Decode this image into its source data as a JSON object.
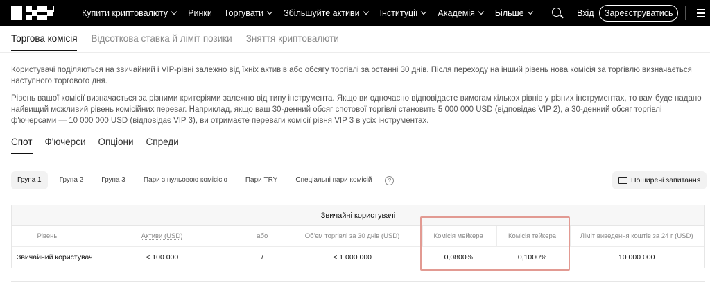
{
  "nav": {
    "items": [
      {
        "label": "Купити криптовалюту",
        "dropdown": true
      },
      {
        "label": "Ринки",
        "dropdown": false
      },
      {
        "label": "Торгувати",
        "dropdown": true
      },
      {
        "label": "Збільшуйте активи",
        "dropdown": true
      },
      {
        "label": "Інституції",
        "dropdown": true
      },
      {
        "label": "Академія",
        "dropdown": true
      },
      {
        "label": "Більше",
        "dropdown": true
      }
    ],
    "login": "Вхід",
    "register": "Зареєструватись",
    "icons": {
      "search": "search-icon",
      "menu": "menu-icon",
      "logo": "okx-logo"
    }
  },
  "top_tabs": [
    "Торгова комісія",
    "Відсоткова ставка й ліміт позики",
    "Зняття криптовалюти"
  ],
  "paragraphs": {
    "p1": "Користувачі поділяються на звичайний і VIP-рівні залежно від їхніх активів або обсягу торгівлі за останні 30 днів. Після переходу на інший рівень нова комісія за торгівлю визначається наступного торгового дня.",
    "p2": "Рівень вашої комісії визначається за різними критеріями залежно від типу інструмента. Якщо ви одночасно відповідаєте вимогам кількох рівнів у різних інструментах, то вам буде надано найвищий можливий рівень комісійних переваг. Наприклад, якщо ваш 30-денний обсяг спотової торгівлі становить 5 000 000 USD (відповідає VIP 2), а 30-денний обсяг торгівлі ф'ючерсами — 10 000 000 USD (відповідає VIP 3), ви отримаєте переваги комісії рівня VIP 3 в усіх інструментах."
  },
  "instrument_tabs": [
    "Спот",
    "Ф'ючерси",
    "Опціони",
    "Спреди"
  ],
  "groups": [
    "Група 1",
    "Група 2",
    "Група 3",
    "Пари з нульовою комісією",
    "Пари TRY",
    "Спеціальні пари комісій"
  ],
  "faq_label": "Поширені запитання",
  "table": {
    "title": "Звичайні користувачі",
    "headers": [
      "Рівень",
      "Активи (USD)",
      "або",
      "Об'єм торгівлі за 30 днів (USD)",
      "Комісія мейкера",
      "Комісія тейкера",
      "Ліміт виведення коштів за 24 г (USD)"
    ],
    "rows": [
      [
        "Звичайний користувач",
        "< 100 000",
        "/",
        "< 1 000 000",
        "0,0800%",
        "0,1000%",
        "10 000 000"
      ]
    ]
  },
  "colors": {
    "nav_bg": "#000000",
    "highlight": "#e29a92",
    "muted_text": "#555555"
  }
}
